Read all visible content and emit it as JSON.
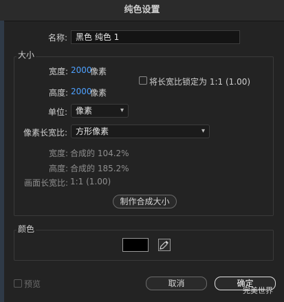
{
  "window": {
    "title": "纯色设置"
  },
  "name": {
    "label": "名称:",
    "value": "黑色 纯色 1"
  },
  "size": {
    "section_label": "大小",
    "width_label": "宽度:",
    "width_value": "2000",
    "width_unit": "像素",
    "height_label": "高度:",
    "height_value": "2000",
    "height_unit": "像素",
    "lock_label": "将长宽比锁定为 1:1 (1.00)",
    "units_label": "单位:",
    "units_value": "像素",
    "pixel_aspect_label": "像素长宽比:",
    "pixel_aspect_value": "方形像素",
    "info": {
      "width_line_label": "宽度:",
      "width_line_value": "合成的 104.2%",
      "height_line_label": "高度:",
      "height_line_value": "合成的 185.2%",
      "frame_line_label": "画面长宽比:",
      "frame_line_value": "1:1 (1.00)"
    },
    "make_comp_size_label": "制作合成大小"
  },
  "color": {
    "section_label": "颜色",
    "swatch_hex": "#000000"
  },
  "footer": {
    "preview_label": "预览",
    "cancel_label": "取消",
    "ok_label": "确定",
    "watermark": "完美世界"
  },
  "icons": {
    "chevron": "chevron-down-icon",
    "eyedropper": "eyedropper-icon"
  }
}
